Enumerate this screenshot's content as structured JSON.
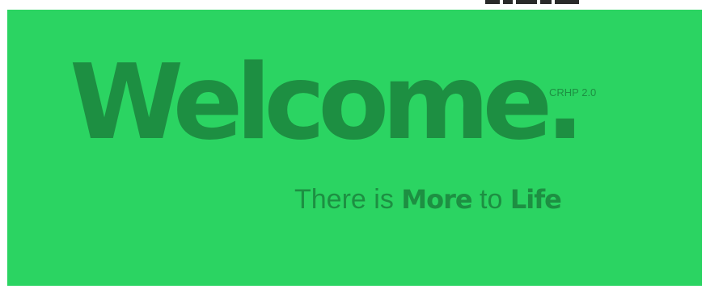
{
  "banner": {
    "headline": "Welcome.",
    "version": "CRHP 2.0",
    "tagline": {
      "part1": "There is ",
      "emphasis1": "More",
      "part2": " to ",
      "emphasis2": "Life"
    }
  },
  "colors": {
    "background": "#2bd462",
    "text": "#1d8f42"
  }
}
